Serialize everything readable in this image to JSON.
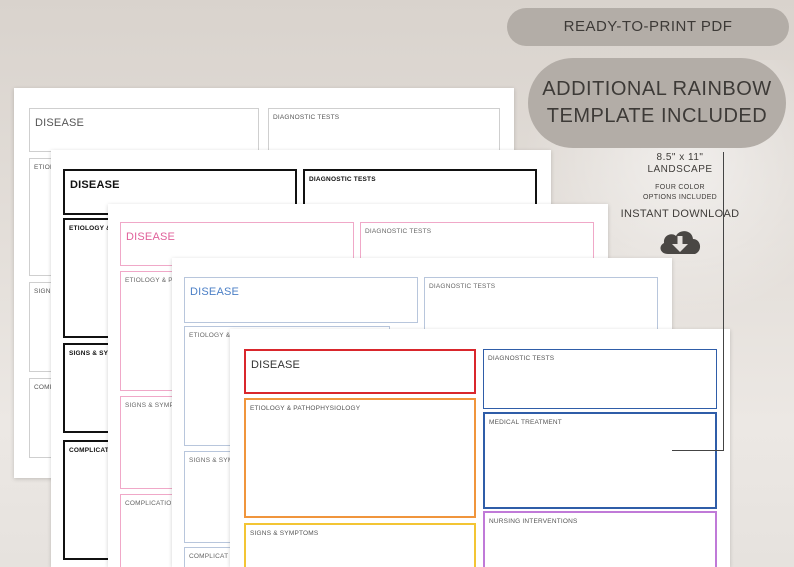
{
  "labels": {
    "disease": "DISEASE",
    "diagnostic_tests": "DIAGNOSTIC TESTS",
    "etiology_short": "ETIOLOGY &",
    "etiology_pa": "ETIOLOGY & PA",
    "etiology_cut": "ETIOLOGY &",
    "etiology_full": "ETIOLOGY & PATHOPHYSIOLOGY",
    "signs_cut1": "SIGNS",
    "signs_cut2": "SIGNS & SYMP",
    "signs_cut3": "SIGNS & SYMP",
    "signs_cut4": "SIGNS & SYM",
    "signs_full": "SIGNS & SYMPTOMS",
    "compl_cut1": "COMPL",
    "compl_cut2": "COMPLICATI",
    "compl_cut3": "COMPLICATION",
    "compl_cut4": "COMPLICAT",
    "medical_treatment": "MEDICAL TREATMENT",
    "nursing_interventions": "NURSING INTERVENTIONS"
  },
  "promo": {
    "pill1": "READY-TO-PRINT PDF",
    "pill2_line1": "ADDITIONAL RAINBOW",
    "pill2_line2": "TEMPLATE INCLUDED",
    "size_line1": "8.5\" x 11\"",
    "size_line2": "LANDSCAPE",
    "colors_line1": "FOUR COLOR",
    "colors_line2": "OPTIONS INCLUDED",
    "download": "INSTANT DOWNLOAD",
    "download_icon": "cloud-download-icon"
  },
  "colors": {
    "gray": "#cfcfcf",
    "black": "#111111",
    "pink": "#f0a8c8",
    "blue_gray": "#b8c6dc",
    "red": "#d9262c",
    "orange": "#f0953c",
    "yellow": "#f3c534",
    "blue": "#2f5da8",
    "purple": "#c07ad8",
    "pill": "#b3ada7"
  }
}
